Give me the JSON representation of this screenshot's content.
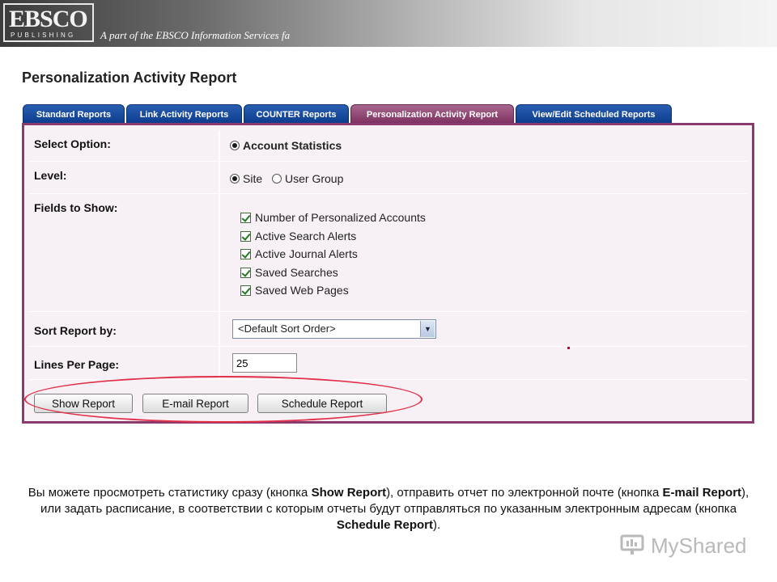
{
  "header": {
    "logo_main": "EBSCO",
    "logo_sub": "PUBLISHING",
    "tagline": "A part of the EBSCO Information Services fa"
  },
  "page_title": "Personalization Activity Report",
  "tabs": [
    {
      "label": "Standard Reports",
      "active": false
    },
    {
      "label": "Link Activity Reports",
      "active": false
    },
    {
      "label": "COUNTER Reports",
      "active": false
    },
    {
      "label": "Personalization Activity Report",
      "active": true
    },
    {
      "label": "View/Edit Scheduled Reports",
      "active": false
    }
  ],
  "form": {
    "select_option": {
      "label": "Select Option:",
      "value": "Account Statistics"
    },
    "level": {
      "label": "Level:",
      "options": [
        "Site",
        "User Group"
      ],
      "selected": "Site"
    },
    "fields_to_show": {
      "label": "Fields to Show:",
      "items": [
        "Number of Personalized Accounts",
        "Active Search Alerts",
        "Active Journal Alerts",
        "Saved Searches",
        "Saved Web Pages"
      ]
    },
    "sort_report_by": {
      "label": "Sort Report by:",
      "value": "<Default Sort Order>"
    },
    "lines_per_page": {
      "label": "Lines Per Page:",
      "value": "25"
    }
  },
  "buttons": {
    "show_report": "Show Report",
    "email_report": "E-mail Report",
    "schedule_report": "Schedule Report"
  },
  "caption": {
    "t1": "Вы можете просмотреть статистику сразу (кнопка ",
    "b1": "Show Report",
    "t2": "), отправить отчет по электронной почте (кнопка ",
    "b2": "E-mail Report",
    "t3": "), или задать расписание, в соответствии с которым отчеты будут отправляться по указанным электронным адресам (кнопка ",
    "b3": "Schedule Report",
    "t4": ")."
  },
  "watermark": "MyShared",
  "colors": {
    "tab_blue": "#0c3b8c",
    "tab_active": "#7d2f5f",
    "panel_border": "#8a3a6c",
    "panel_bg": "#f7f1f5",
    "highlight": "#e0304a"
  }
}
